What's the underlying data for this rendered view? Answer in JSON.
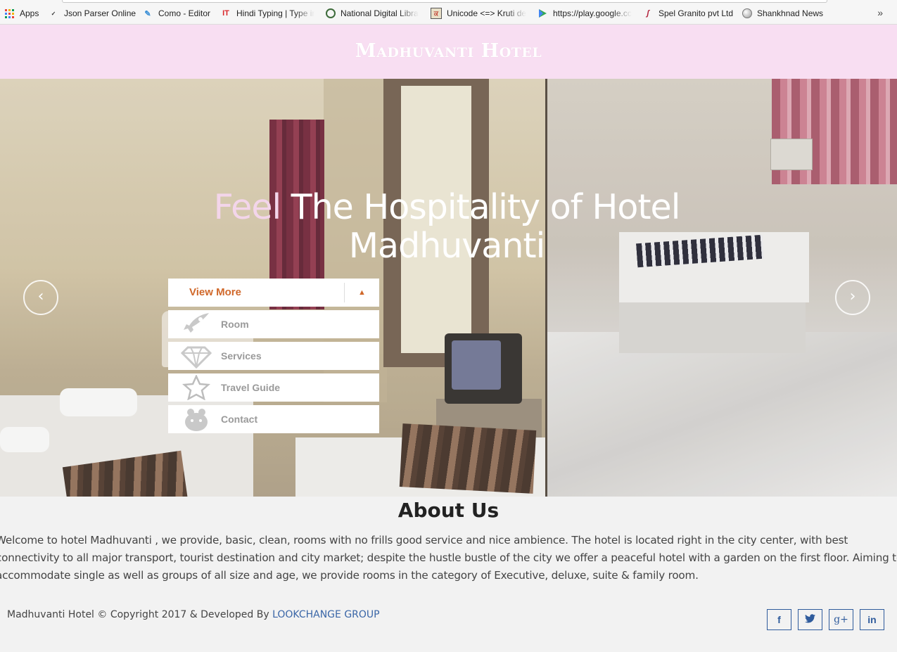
{
  "bookmarks": [
    {
      "label": "Apps",
      "icon": "apps-grid-icon"
    },
    {
      "label": "Json Parser Online",
      "icon": "json-icon"
    },
    {
      "label": "Como - Editor",
      "icon": "feather-icon"
    },
    {
      "label": "Hindi Typing | Type ir",
      "icon": "it-icon"
    },
    {
      "label": "National Digital Libra",
      "icon": "globe-icon"
    },
    {
      "label": "Unicode <=> Kruti de",
      "icon": "kruti-icon"
    },
    {
      "label": "https://play.google.cc",
      "icon": "play-icon"
    },
    {
      "label": "Spel Granito pvt Ltd",
      "icon": "spel-icon"
    },
    {
      "label": "Shankhnad News",
      "icon": "ball-icon"
    }
  ],
  "bookmarks_more": "»",
  "header": {
    "brand": "Madhuvanti Hotel"
  },
  "hero": {
    "title_highlight": "Feel",
    "title_rest": " The Hospitality of Hotel Madhuvanti",
    "prev_arrow": "‹",
    "next_arrow": "›"
  },
  "menu": {
    "head_label": "View More",
    "caret": "▲",
    "items": [
      {
        "label": "Room",
        "icon": "rocket-icon"
      },
      {
        "label": "Services",
        "icon": "diamond-icon"
      },
      {
        "label": "Travel Guide",
        "icon": "star-icon"
      },
      {
        "label": "Contact",
        "icon": "bear-icon"
      }
    ]
  },
  "about": {
    "title": "About Us",
    "text": "Welcome to hotel Madhuvanti , we provide, basic, clean, rooms with no frills good service and nice ambience. The hotel is located right in the city center, with best connectivity to all major transport, tourist destination and city market; despite the hustle bustle of the city we offer a peaceful hotel with a garden on the first floor. Aiming to accommodate single as well as groups of all size and age, we provide rooms in the category of Executive, deluxe, suite & family room."
  },
  "footer": {
    "copyright": "Madhuvanti Hotel © Copyright 2017 & Developed By ",
    "developer": "LOOKCHANGE GROUP",
    "social": [
      {
        "label": "f",
        "icon": "facebook-icon"
      },
      {
        "label": "🐦",
        "icon": "twitter-icon"
      },
      {
        "label": "g+",
        "icon": "google-plus-icon"
      },
      {
        "label": "in",
        "icon": "linkedin-icon"
      }
    ]
  },
  "colors": {
    "header_bg": "#f8def2",
    "accent": "#d0682a",
    "link": "#3a66a7",
    "social_border": "#2f5b9c"
  }
}
